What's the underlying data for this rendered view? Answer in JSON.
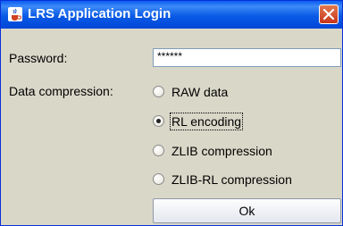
{
  "window": {
    "title": "LRS Application Login",
    "icon": "java-cup-icon",
    "close_icon": "close-icon"
  },
  "password": {
    "label": "Password:",
    "value": "******"
  },
  "compression": {
    "label": "Data compression:",
    "options": [
      {
        "label": "RAW data",
        "checked": false
      },
      {
        "label": "RL encoding",
        "checked": true
      },
      {
        "label": "ZLIB compression",
        "checked": false
      },
      {
        "label": "ZLIB-RL compression",
        "checked": false
      }
    ]
  },
  "ok_button": {
    "label": "Ok"
  },
  "colors": {
    "titlebar": "#0a5ae6",
    "close_button": "#c7341b",
    "background": "#d9d7c8"
  }
}
